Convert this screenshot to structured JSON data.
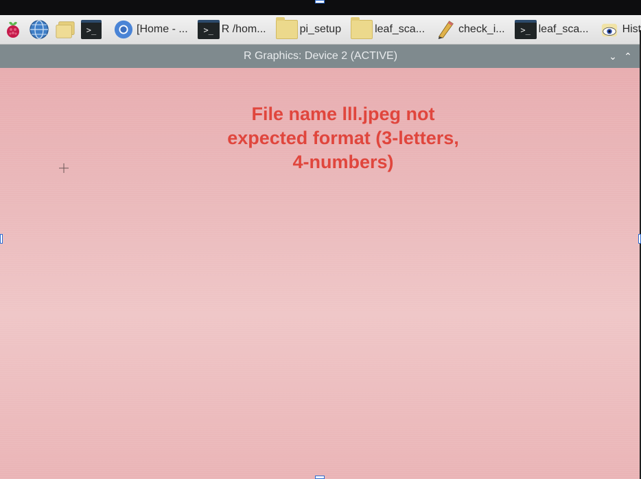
{
  "taskbar": {
    "launchers": [
      {
        "name": "raspberry-menu-icon"
      },
      {
        "name": "web-browser-icon"
      },
      {
        "name": "file-manager-icon"
      },
      {
        "name": "terminal-icon"
      }
    ],
    "tasks": [
      {
        "icon": "chromium-icon",
        "label": "[Home - ..."
      },
      {
        "icon": "terminal-icon",
        "label": "R /hom..."
      },
      {
        "icon": "folder-icon",
        "label": "pi_setup"
      },
      {
        "icon": "folder-icon",
        "label": "leaf_sca..."
      },
      {
        "icon": "text-editor-icon",
        "label": "check_i..."
      },
      {
        "icon": "terminal-icon",
        "label": "leaf_sca..."
      },
      {
        "icon": "image-viewer-icon",
        "label": "Histogra..."
      }
    ]
  },
  "window": {
    "title": "R Graphics: Device 2 (ACTIVE)",
    "controls": {
      "minimize": "⌄",
      "maximize": "⌃"
    }
  },
  "plot": {
    "message_line1": "File name lll.jpeg not",
    "message_line2": "expected format (3-letters,",
    "message_line3": "4-numbers)",
    "text_color": "#e0463d",
    "background_color": "#eab6b8"
  }
}
